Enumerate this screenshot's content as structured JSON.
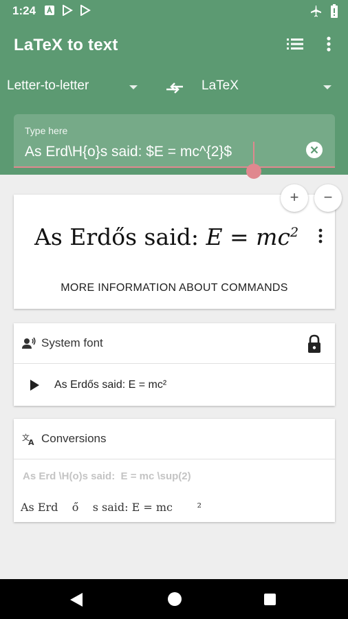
{
  "status_bar": {
    "time": "1:24",
    "left_icons": [
      "notification-a-icon",
      "play-store-icon",
      "play-store-icon"
    ],
    "right_icons": [
      "airplane-mode-icon",
      "battery-icon"
    ]
  },
  "app_bar": {
    "title": "LaTeX to text",
    "actions": [
      "list-icon",
      "more-vert-icon"
    ]
  },
  "conversion": {
    "from": "Letter-to-letter",
    "to": "LaTeX"
  },
  "input": {
    "label": "Type here",
    "value": "As Erd\\H{o}s said: $E = mc^{2}$"
  },
  "zoom": {
    "in": "+",
    "out": "−"
  },
  "preview": {
    "text_plain": "As Erdős said: ",
    "math_lhs": "E",
    "math_eq": " = ",
    "math_rhs": "mc",
    "math_sup": "2",
    "more_info": "MORE INFORMATION ABOUT COMMANDS"
  },
  "system_font": {
    "title": "System font",
    "output": "As Erdős said: E = mc²"
  },
  "conversions": {
    "title": "Conversions",
    "line1": "As Erd \\H(o)s said:  E = mc \\sup(2)",
    "line2": "As Erd    ő    s said: E = mc       ²"
  },
  "colors": {
    "primary": "#5c9a72",
    "accent": "#e0888f"
  }
}
